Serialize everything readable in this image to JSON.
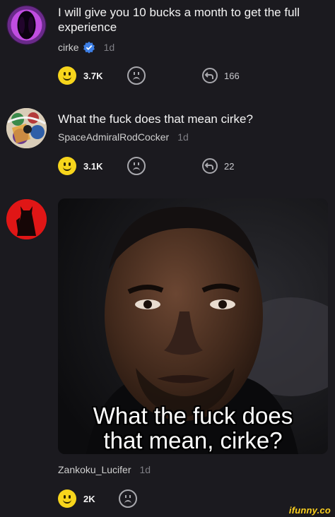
{
  "comments": [
    {
      "text": "I will give you 10 bucks a month to get the full experience",
      "author": "cirke",
      "verified": true,
      "time": "1d",
      "smiles": "3.7K",
      "replies": "166"
    },
    {
      "text": "What the fuck does that mean cirke?",
      "author": "SpaceAdmiralRodCocker",
      "time": "1d",
      "smiles": "3.1K",
      "replies": "22"
    },
    {
      "meme_caption_line1": "What the fuck does",
      "meme_caption_line2": "that mean, cirke?",
      "author": "Zankoku_Lucifer",
      "time": "1d",
      "smiles": "2K"
    }
  ],
  "watermark": "ifunny.co",
  "colors": {
    "background": "#1b1a1f",
    "smile": "#f7d51c",
    "verified": "#3d7fe6",
    "watermark": "#ffd21f"
  }
}
